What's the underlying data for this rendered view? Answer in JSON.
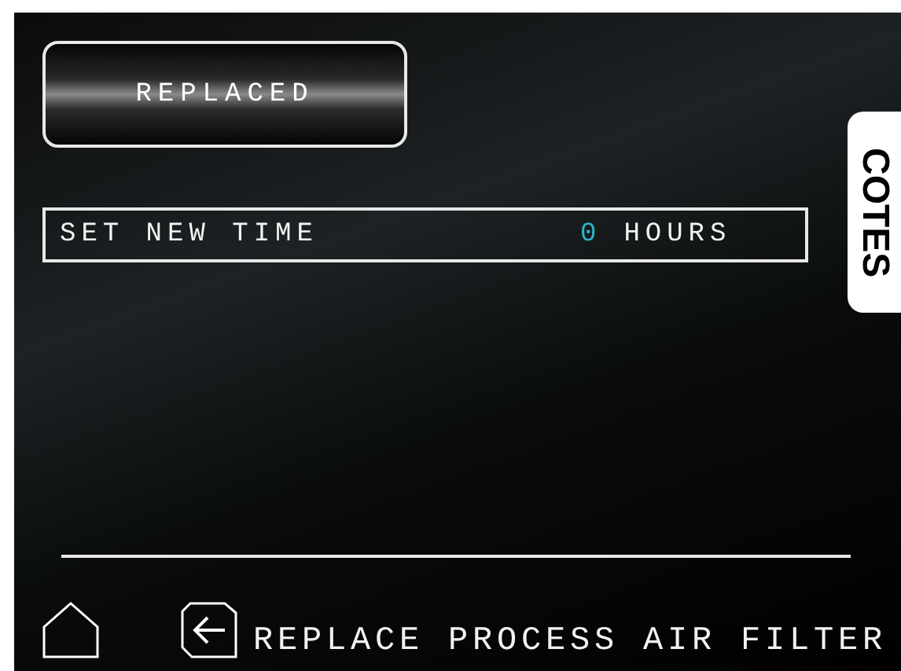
{
  "replaced_button": {
    "label": "REPLACED"
  },
  "time_field": {
    "label": "SET NEW TIME",
    "value": "0",
    "unit": "HOURS"
  },
  "side_tab": {
    "label": "COTES"
  },
  "footer": {
    "title": "REPLACE PROCESS AIR FILTER"
  }
}
